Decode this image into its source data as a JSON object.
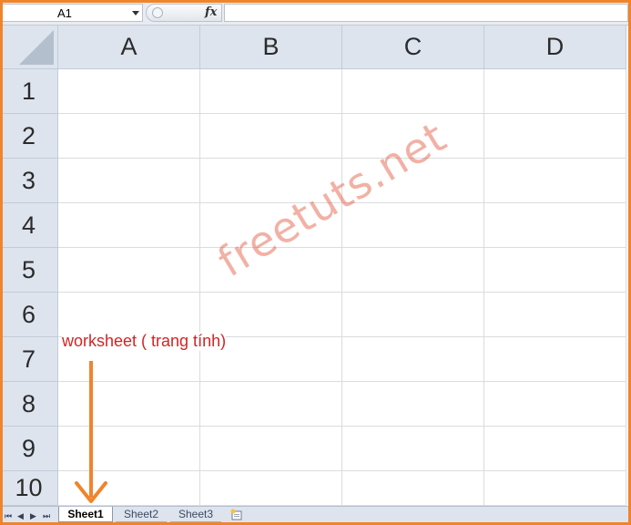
{
  "formula_bar": {
    "name_box_value": "A1",
    "fx_label": "fx",
    "formula_value": ""
  },
  "columns": [
    "A",
    "B",
    "C",
    "D"
  ],
  "rows": [
    "1",
    "2",
    "3",
    "4",
    "5",
    "6",
    "7",
    "8",
    "9",
    "10"
  ],
  "sheet_tabs": [
    {
      "label": "Sheet1",
      "active": true
    },
    {
      "label": "Sheet2",
      "active": false
    },
    {
      "label": "Sheet3",
      "active": false
    }
  ],
  "nav_buttons": [
    "⏮",
    "◀",
    "▶",
    "⏭"
  ],
  "watermark": "freetuts.net",
  "annotation": {
    "text": "worksheet ( trang tính)",
    "color": "#d62323",
    "arrow_color": "#f0842b"
  },
  "colors": {
    "frame": "#f0842b",
    "header_bg": "#dde4ee",
    "gridline": "#dadcdd"
  }
}
